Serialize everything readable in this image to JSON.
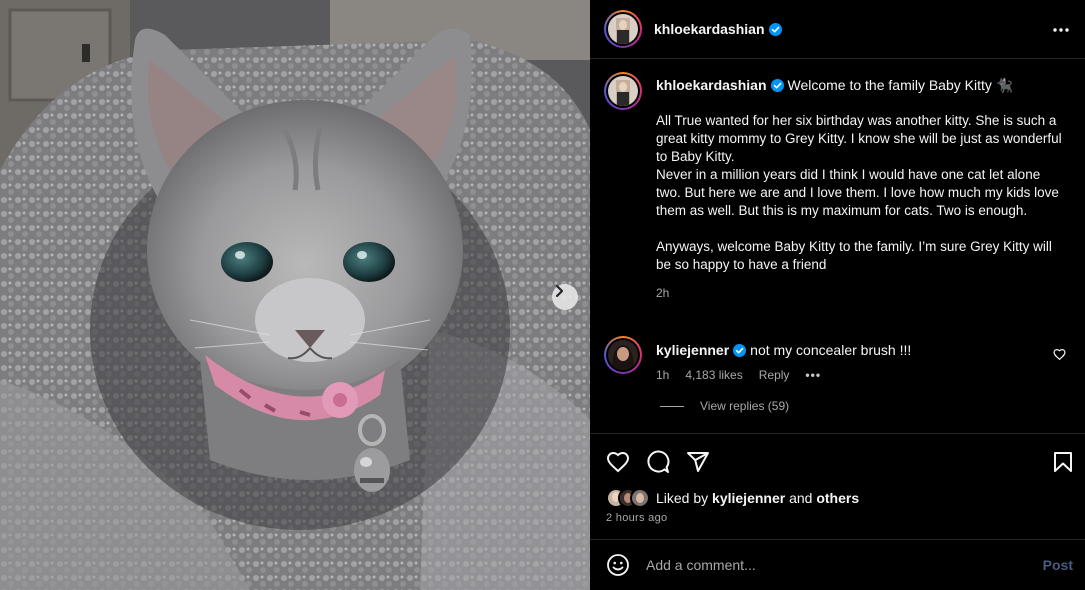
{
  "post": {
    "author": "khloekardashian",
    "caption_title": "Welcome to the family Baby Kitty 🐈‍⬛",
    "caption_para1": "All True wanted for her six birthday was another kitty. She is such a great kitty mommy to Grey Kitty. I know she will be just as wonderful to Baby Kitty.\nNever in a million years did I think I would have one cat let alone two. But here we are and I love them. I love how much my kids love them as well. But this is my maximum for cats. Two is enough.",
    "caption_para2": "Anyways, welcome Baby Kitty to the family. I’m sure Grey Kitty will be so happy to have a friend",
    "caption_time": "2h"
  },
  "comment": {
    "author": "kyliejenner",
    "text": "not my concealer brush !!!",
    "time": "1h",
    "likes": "4,183 likes",
    "reply_label": "Reply",
    "view_replies": "View replies (59)"
  },
  "likes": {
    "prefix": "Liked by",
    "user": "kyliejenner",
    "and": "and",
    "others": "others"
  },
  "posted": "2 hours ago",
  "comment_box": {
    "placeholder": "Add a comment...",
    "post_label": "Post"
  },
  "icons": [
    "verified-badge-icon",
    "more-icon",
    "heart-icon",
    "comment-icon",
    "share-icon",
    "save-icon",
    "emoji-icon",
    "chevron-right-icon"
  ],
  "colors": {
    "verified": "#0095f6",
    "post_disabled": "#4a5a80",
    "divider": "#262626"
  }
}
